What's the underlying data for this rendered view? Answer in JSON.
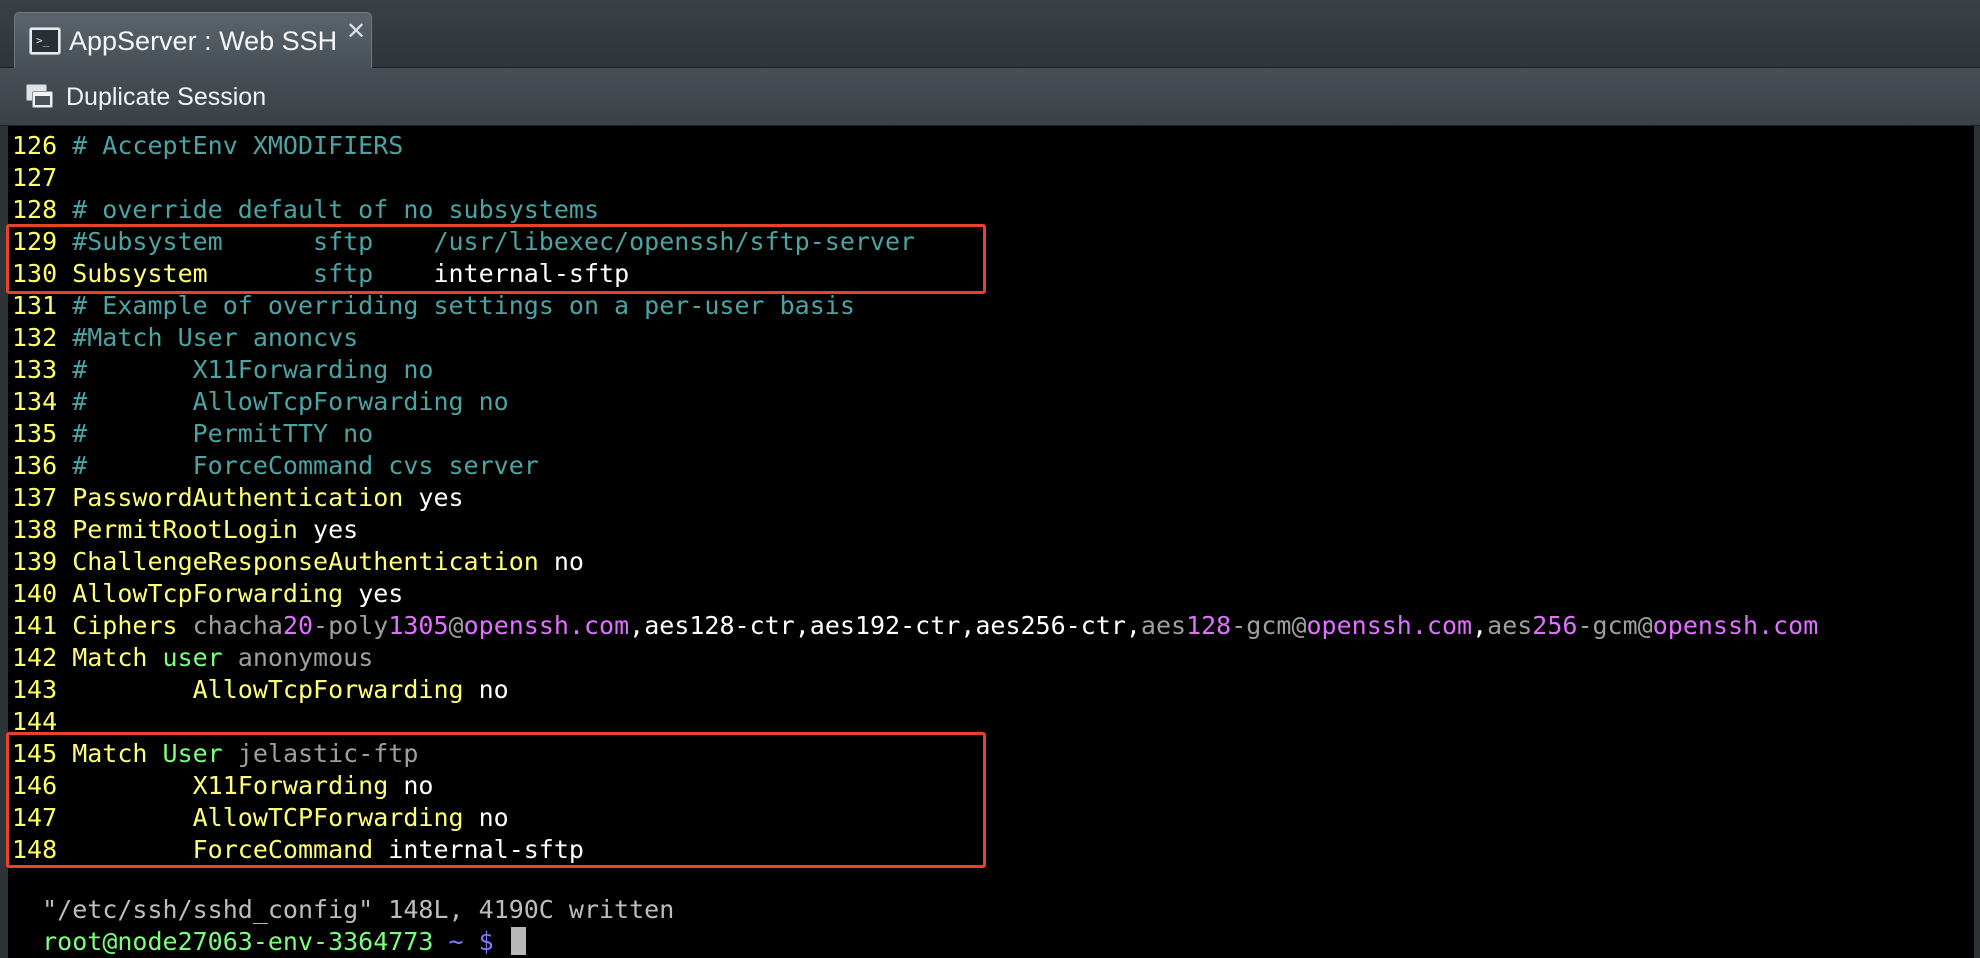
{
  "window": {
    "tab_title": "AppServer : Web SSH",
    "close_symbol": "✕",
    "terminal_icon_glyph": ">_"
  },
  "toolbar": {
    "duplicate_label": "Duplicate Session"
  },
  "colors": {
    "highlight": "#e8422b",
    "line_number": "#ffff66",
    "comment": "#4ba3a3",
    "keyword": "#ffff77",
    "prompt": "#7cff7c",
    "magenta": "#e070ff"
  },
  "terminal": {
    "lines": [
      {
        "n": "126",
        "segs": [
          {
            "t": " # AcceptEnv XMODIFIERS",
            "c": "com"
          }
        ]
      },
      {
        "n": "127",
        "segs": []
      },
      {
        "n": "128",
        "segs": [
          {
            "t": " # override default of no subsystems",
            "c": "com"
          }
        ]
      },
      {
        "n": "129",
        "segs": [
          {
            "t": " #Subsystem      sftp    /usr/libexec/openssh/sftp-server",
            "c": "com"
          }
        ]
      },
      {
        "n": "130",
        "segs": [
          {
            "t": " Subsystem",
            "c": "kw"
          },
          {
            "t": "       sftp    ",
            "c": "com"
          },
          {
            "t": "internal-sftp",
            "c": "val"
          }
        ]
      },
      {
        "n": "131",
        "segs": [
          {
            "t": " # Example of overriding settings on a per-user basis",
            "c": "com"
          }
        ]
      },
      {
        "n": "132",
        "segs": [
          {
            "t": " #Match User anoncvs",
            "c": "com"
          }
        ]
      },
      {
        "n": "133",
        "segs": [
          {
            "t": " #       X11Forwarding no",
            "c": "com"
          }
        ]
      },
      {
        "n": "134",
        "segs": [
          {
            "t": " #       AllowTcpForwarding no",
            "c": "com"
          }
        ]
      },
      {
        "n": "135",
        "segs": [
          {
            "t": " #       PermitTTY no",
            "c": "com"
          }
        ]
      },
      {
        "n": "136",
        "segs": [
          {
            "t": " #       ForceCommand cvs server",
            "c": "com"
          }
        ]
      },
      {
        "n": "137",
        "segs": [
          {
            "t": " PasswordAuthentication",
            "c": "kw"
          },
          {
            "t": " yes",
            "c": "val"
          }
        ]
      },
      {
        "n": "138",
        "segs": [
          {
            "t": " PermitRootLogin",
            "c": "kw"
          },
          {
            "t": " yes",
            "c": "val"
          }
        ]
      },
      {
        "n": "139",
        "segs": [
          {
            "t": " ChallengeResponseAuthentication",
            "c": "kw"
          },
          {
            "t": " no",
            "c": "val"
          }
        ]
      },
      {
        "n": "140",
        "segs": [
          {
            "t": " AllowTcpForwarding",
            "c": "kw"
          },
          {
            "t": " yes",
            "c": "val"
          }
        ]
      },
      {
        "n": "141",
        "segs": [
          {
            "t": " Ciphers",
            "c": "kw"
          },
          {
            "t": " chacha",
            "c": "dim"
          },
          {
            "t": "20",
            "c": "num"
          },
          {
            "t": "-poly",
            "c": "dim"
          },
          {
            "t": "1305",
            "c": "num"
          },
          {
            "t": "@",
            "c": "dim"
          },
          {
            "t": "openssh.com",
            "c": "num"
          },
          {
            "t": ",aes128-ctr,aes192-ctr,aes256-ctr,",
            "c": "val"
          },
          {
            "t": "aes",
            "c": "dim"
          },
          {
            "t": "128",
            "c": "num"
          },
          {
            "t": "-gcm@",
            "c": "dim"
          },
          {
            "t": "openssh.com",
            "c": "num"
          },
          {
            "t": ",",
            "c": "val"
          },
          {
            "t": "aes",
            "c": "dim"
          },
          {
            "t": "256",
            "c": "num"
          },
          {
            "t": "-gcm@",
            "c": "dim"
          },
          {
            "t": "openssh.com",
            "c": "num"
          }
        ]
      },
      {
        "n": "142",
        "segs": [
          {
            "t": " Match",
            "c": "kw"
          },
          {
            "t": " user",
            "c": "prm"
          },
          {
            "t": " anonymous",
            "c": "dim"
          }
        ]
      },
      {
        "n": "143",
        "segs": [
          {
            "t": "         AllowTcpForwarding",
            "c": "kw"
          },
          {
            "t": " no",
            "c": "val"
          }
        ]
      },
      {
        "n": "144",
        "segs": []
      },
      {
        "n": "145",
        "segs": [
          {
            "t": " Match",
            "c": "kw"
          },
          {
            "t": " User",
            "c": "prm"
          },
          {
            "t": " jelastic-ftp",
            "c": "dim"
          }
        ]
      },
      {
        "n": "146",
        "segs": [
          {
            "t": "         X11Forwarding",
            "c": "kw"
          },
          {
            "t": " no",
            "c": "val"
          }
        ]
      },
      {
        "n": "147",
        "segs": [
          {
            "t": "         AllowTCPForwarding",
            "c": "kw"
          },
          {
            "t": " no",
            "c": "val"
          }
        ]
      },
      {
        "n": "148",
        "segs": [
          {
            "t": "         ForceCommand",
            "c": "kw"
          },
          {
            "t": " internal-sftp",
            "c": "val"
          }
        ]
      }
    ],
    "status_line": "\"/etc/ssh/sshd_config\" 148L, 4190C written",
    "prompt": {
      "user_host": "root@node27063-env-3364773",
      "path": " ~ ",
      "symbol": "$"
    }
  }
}
